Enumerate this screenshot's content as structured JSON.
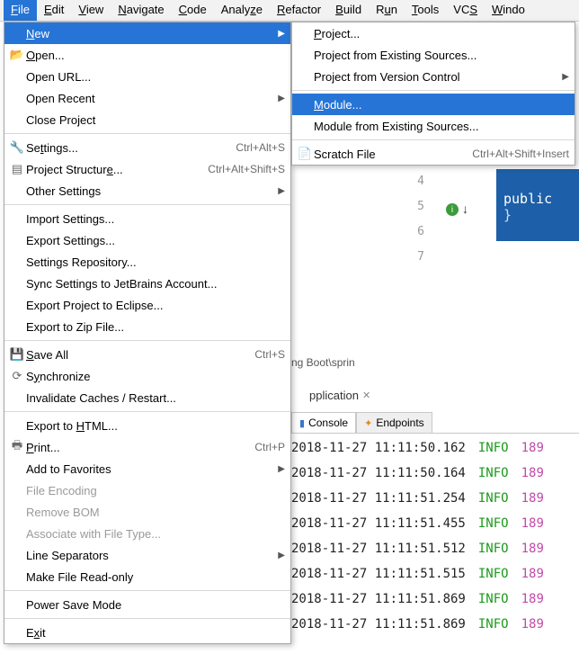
{
  "menubar": {
    "items": [
      {
        "pre": "",
        "u": "F",
        "post": "ile"
      },
      {
        "pre": "",
        "u": "E",
        "post": "dit"
      },
      {
        "pre": "",
        "u": "V",
        "post": "iew"
      },
      {
        "pre": "",
        "u": "N",
        "post": "avigate"
      },
      {
        "pre": "",
        "u": "C",
        "post": "ode"
      },
      {
        "pre": "Analy",
        "u": "z",
        "post": "e"
      },
      {
        "pre": "",
        "u": "R",
        "post": "efactor"
      },
      {
        "pre": "",
        "u": "B",
        "post": "uild"
      },
      {
        "pre": "R",
        "u": "u",
        "post": "n"
      },
      {
        "pre": "",
        "u": "T",
        "post": "ools"
      },
      {
        "pre": "VC",
        "u": "S",
        "post": ""
      },
      {
        "pre": "",
        "u": "W",
        "post": "indo"
      }
    ]
  },
  "fileMenu": {
    "new": {
      "pre": "",
      "u": "N",
      "post": "ew"
    },
    "open": {
      "pre": "",
      "u": "O",
      "post": "pen..."
    },
    "openUrl": {
      "label": "Open URL..."
    },
    "openRecent": {
      "label": "Open Recent"
    },
    "closeProject": {
      "pre": "Close Pro",
      "u": "j",
      "post": "ect"
    },
    "settings": {
      "pre": "Se",
      "u": "t",
      "post": "tings...",
      "shortcut": "Ctrl+Alt+S"
    },
    "projectStructure": {
      "pre": "Project Structur",
      "u": "e",
      "post": "...",
      "shortcut": "Ctrl+Alt+Shift+S"
    },
    "otherSettings": {
      "label": "Other Settings"
    },
    "importSettings": {
      "label": "Import Settings..."
    },
    "exportSettings": {
      "label": "Export Settings..."
    },
    "settingsRepo": {
      "label": "Settings Repository..."
    },
    "syncJetbrains": {
      "label": "Sync Settings to JetBrains Account..."
    },
    "exportEclipse": {
      "label": "Export Project to Eclipse..."
    },
    "exportZip": {
      "label": "Export to Zip File..."
    },
    "saveAll": {
      "pre": "",
      "u": "S",
      "post": "ave All",
      "shortcut": "Ctrl+S"
    },
    "synchronize": {
      "pre": "S",
      "u": "y",
      "post": "nchronize"
    },
    "invalidate": {
      "label": "Invalidate Caches / Restart..."
    },
    "exportHtml": {
      "pre": "Export to ",
      "u": "H",
      "post": "TML..."
    },
    "print": {
      "pre": "",
      "u": "P",
      "post": "rint...",
      "shortcut": "Ctrl+P"
    },
    "addFav": {
      "label": "Add to Favorites"
    },
    "fileEncoding": {
      "label": "File Encoding"
    },
    "removeBom": {
      "label": "Remove BOM"
    },
    "assocFileType": {
      "label": "Associate with File Type..."
    },
    "lineSep": {
      "label": "Line Separators"
    },
    "readOnly": {
      "label": "Make File Read-only"
    },
    "powerSave": {
      "label": "Power Save Mode"
    },
    "exit": {
      "pre": "E",
      "u": "x",
      "post": "it"
    }
  },
  "newSubmenu": {
    "project": {
      "pre": "",
      "u": "P",
      "post": "roject..."
    },
    "projectExisting": {
      "label": "Project from Existing Sources..."
    },
    "projectVcs": {
      "label": "Project from Version Control"
    },
    "module": {
      "pre": "",
      "u": "M",
      "post": "odule..."
    },
    "moduleExisting": {
      "label": "Module from Existing Sources..."
    },
    "scratch": {
      "label": "Scratch File",
      "shortcut": "Ctrl+Alt+Shift+Insert"
    }
  },
  "bg": {
    "gutter": [
      "4",
      "5",
      "6",
      "7"
    ],
    "codeWord": "public",
    "codeBrace": "}",
    "breadcrumb": "ng Boot\\sprin",
    "runTab": "pplication",
    "tabs": {
      "console": "Console",
      "endpoints": "Endpoints"
    },
    "logs": [
      {
        "ts": "2018-11-27 11:11:50.162",
        "lvl": "INFO",
        "pid": "189"
      },
      {
        "ts": "2018-11-27 11:11:50.164",
        "lvl": "INFO",
        "pid": "189"
      },
      {
        "ts": "2018-11-27 11:11:51.254",
        "lvl": "INFO",
        "pid": "189"
      },
      {
        "ts": "2018-11-27 11:11:51.455",
        "lvl": "INFO",
        "pid": "189"
      },
      {
        "ts": "2018-11-27 11:11:51.512",
        "lvl": "INFO",
        "pid": "189"
      },
      {
        "ts": "2018-11-27 11:11:51.515",
        "lvl": "INFO",
        "pid": "189"
      },
      {
        "ts": "2018-11-27 11:11:51.869",
        "lvl": "INFO",
        "pid": "189"
      },
      {
        "ts": "2018-11-27 11:11:51.869",
        "lvl": "INFO",
        "pid": "189"
      }
    ]
  }
}
